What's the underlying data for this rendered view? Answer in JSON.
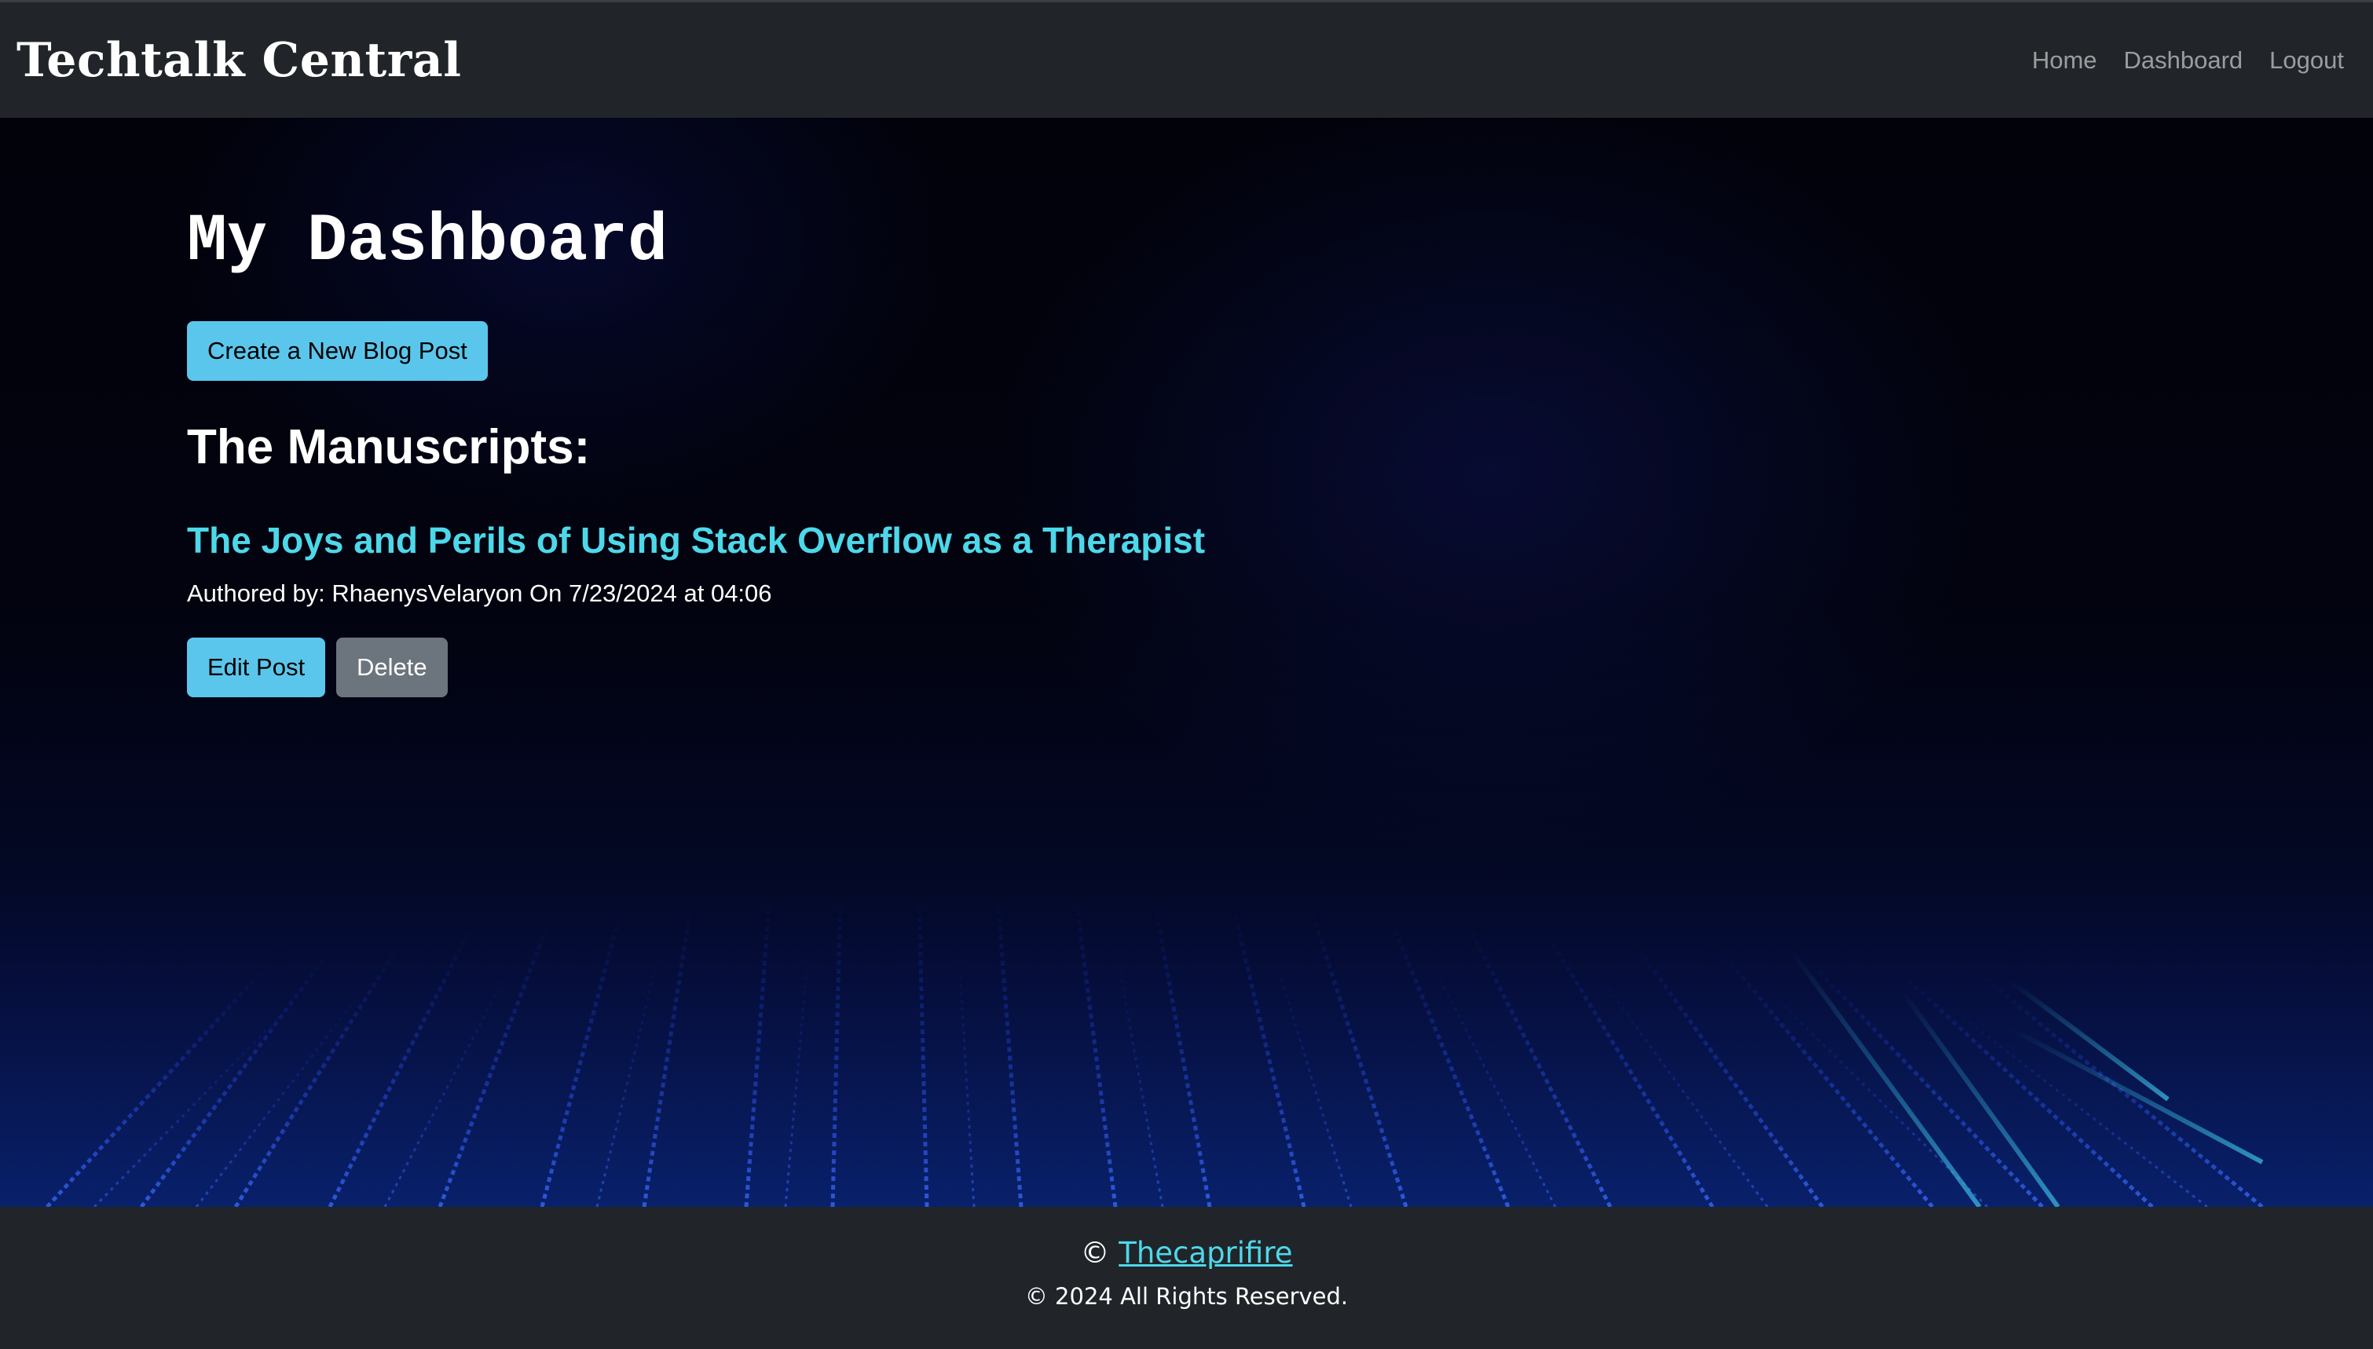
{
  "navbar": {
    "brand": "Techtalk Central",
    "links": [
      {
        "label": "Home"
      },
      {
        "label": "Dashboard"
      },
      {
        "label": "Logout"
      }
    ]
  },
  "main": {
    "title": "My Dashboard",
    "create_button_label": "Create a New Blog Post",
    "section_heading": "The Manuscripts:",
    "posts": [
      {
        "title": "The Joys and Perils of Using Stack Overflow as a Therapist",
        "meta": "Authored by: RhaenysVelaryon On 7/23/2024 at 04:06",
        "edit_label": "Edit Post",
        "delete_label": "Delete"
      }
    ]
  },
  "footer": {
    "copyright_symbol": "©",
    "author_link": "Thecaprifire",
    "rights": "© 2024 All Rights Reserved."
  },
  "colors": {
    "navbar_bg": "#212529",
    "accent_info": "#5bc6ec",
    "post_title": "#4dd8ea",
    "secondary": "#6c757d"
  }
}
